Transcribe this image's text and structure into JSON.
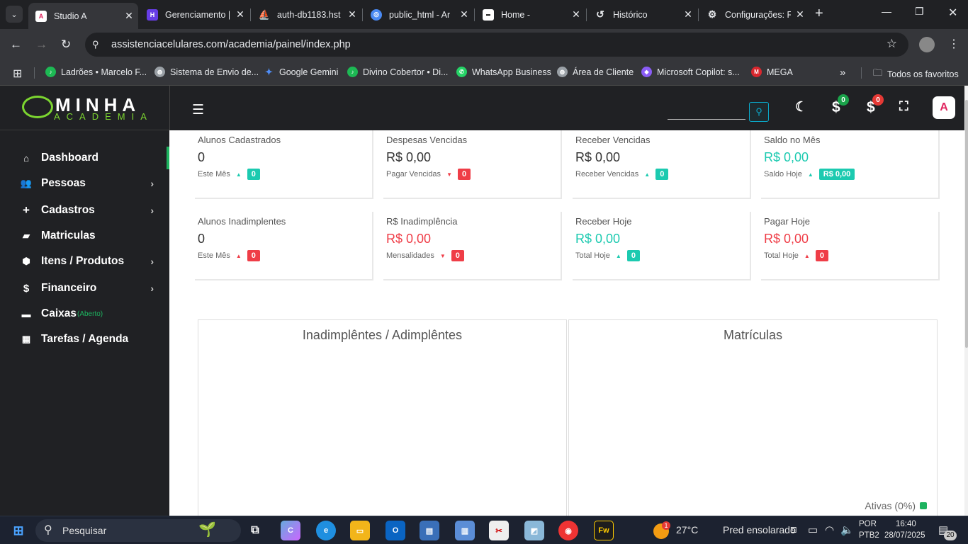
{
  "browser": {
    "tabs": [
      {
        "label": "Studio A",
        "icon": "studio-a-favicon",
        "active": true
      },
      {
        "label": "Gerenciamento |",
        "icon": "hostinger-favicon"
      },
      {
        "label": "auth-db1183.hst",
        "icon": "phpmyadmin-favicon"
      },
      {
        "label": "public_html - Ar",
        "icon": "file-manager-favicon"
      },
      {
        "label": "Home -",
        "icon": "home-favicon"
      },
      {
        "label": "Histórico",
        "icon": "history-icon"
      },
      {
        "label": "Configurações: F",
        "icon": "settings-icon"
      }
    ],
    "url": "assistenciacelulares.com/academia/painel/index.php",
    "bookmarks": [
      {
        "label": "Ladrões • Marcelo F...",
        "icon": "spotify-icon",
        "color": "#1db954"
      },
      {
        "label": "Sistema de Envio de...",
        "icon": "globe-icon",
        "color": "#9aa0a6"
      },
      {
        "label": "Google Gemini",
        "icon": "gemini-icon",
        "color": "#4f8df5"
      },
      {
        "label": "Divino Cobertor • Di...",
        "icon": "spotify-icon",
        "color": "#1db954"
      },
      {
        "label": "WhatsApp Business",
        "icon": "whatsapp-icon",
        "color": "#25d366"
      },
      {
        "label": "Área de Cliente",
        "icon": "globe-icon",
        "color": "#9aa0a6"
      },
      {
        "label": "Microsoft Copilot: s...",
        "icon": "copilot-icon",
        "color": "#8a5cf6"
      },
      {
        "label": "MEGA",
        "icon": "mega-icon",
        "color": "#d9272e"
      }
    ],
    "all_bookmarks": "Todos os favoritos"
  },
  "sidebar": {
    "logo_top": "MINHA",
    "logo_bottom": "ACADEMIA",
    "items": [
      {
        "label": "Dashboard",
        "icon": "home-icon",
        "active": true
      },
      {
        "label": "Pessoas",
        "icon": "users-icon",
        "submenu": true
      },
      {
        "label": "Cadastros",
        "icon": "plus-icon",
        "submenu": true
      },
      {
        "label": "Matriculas",
        "icon": "book-icon"
      },
      {
        "label": "Itens / Produtos",
        "icon": "box-icon",
        "submenu": true
      },
      {
        "label": "Financeiro",
        "icon": "dollar-icon",
        "submenu": true
      },
      {
        "label": "Caixas",
        "icon": "briefcase-icon",
        "badge": "(Aberto)"
      },
      {
        "label": "Tarefas / Agenda",
        "icon": "calendar-icon"
      }
    ]
  },
  "topbar": {
    "badge_receive": "0",
    "badge_pay": "0",
    "colors": {
      "green": "#1aa34a",
      "red": "#e53935"
    }
  },
  "cards": [
    {
      "title": "Alunos Cadastrados",
      "value": "0",
      "sub": "Este Mês",
      "badge": "0",
      "trend": "up",
      "value_color": "#333",
      "badge_color": "#1ccab0"
    },
    {
      "title": "Despesas Vencidas",
      "value": "R$ 0,00",
      "sub": "Pagar Vencidas",
      "badge": "0",
      "trend": "down",
      "value_color": "#333",
      "badge_color": "#ef3d47"
    },
    {
      "title": "Receber Vencidas",
      "value": "R$ 0,00",
      "sub": "Receber Vencidas",
      "badge": "0",
      "trend": "up",
      "value_color": "#333",
      "badge_color": "#1ccab0"
    },
    {
      "title": "Saldo no Mês",
      "value": "R$ 0,00",
      "sub": "Saldo Hoje",
      "badge": "R$ 0,00",
      "trend": "up",
      "value_color": "#1ccab0",
      "badge_color": "#1ccab0"
    },
    {
      "title": "Alunos Inadimplentes",
      "value": "0",
      "sub": "Este Mês",
      "badge": "0",
      "trend": "up-red",
      "value_color": "#333",
      "badge_color": "#ef3d47"
    },
    {
      "title": "R$ Inadimplência",
      "value": "R$ 0,00",
      "sub": "Mensalidades",
      "badge": "0",
      "trend": "down",
      "value_color": "#ef3d47",
      "badge_color": "#ef3d47"
    },
    {
      "title": "Receber Hoje",
      "value": "R$ 0,00",
      "sub": "Total Hoje",
      "badge": "0",
      "trend": "up",
      "value_color": "#1ccab0",
      "badge_color": "#1ccab0"
    },
    {
      "title": "Pagar Hoje",
      "value": "R$ 0,00",
      "sub": "Total Hoje",
      "badge": "0",
      "trend": "up-red",
      "value_color": "#ef3d47",
      "badge_color": "#ef3d47"
    }
  ],
  "charts": {
    "left_title": "Inadimplêntes / Adimplêntes",
    "right_title": "Matrículas",
    "legend_label": "Ativas (0%)"
  },
  "taskbar": {
    "search": "Pesquisar",
    "weather_temp": "27°C",
    "weather_text": "Pred ensolarado",
    "weather_badge": "1",
    "lang_top": "POR",
    "lang_bottom": "PTB2",
    "time": "16:40",
    "date": "28/07/2025",
    "notif_count": "20"
  }
}
